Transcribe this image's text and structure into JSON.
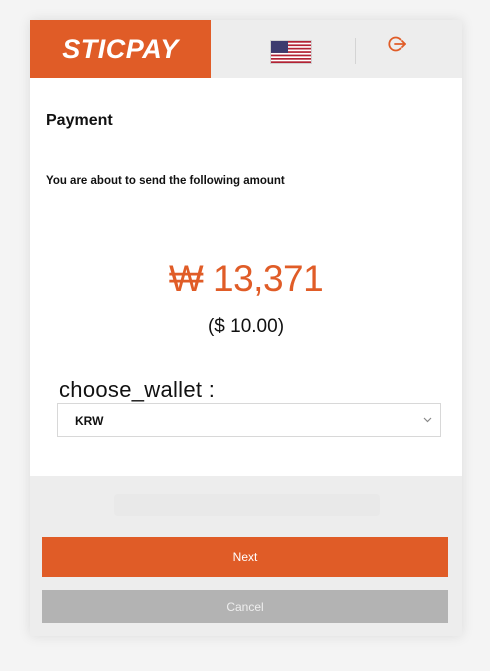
{
  "header": {
    "logo_text": "STICPAY",
    "flag_icon": "us-flag-icon",
    "logout_icon": "logout-icon"
  },
  "page": {
    "title": "Payment",
    "subtitle": "You are about to send the following amount",
    "amount": "₩ 13,371",
    "converted_amount": "($ 10.00)",
    "wallet_label": "choose_wallet :",
    "wallet_selected": "KRW"
  },
  "actions": {
    "next_label": "Next",
    "cancel_label": "Cancel"
  },
  "colors": {
    "brand": "#e05c27",
    "cancel": "#b3b3b3",
    "background_gray": "#ededed"
  }
}
